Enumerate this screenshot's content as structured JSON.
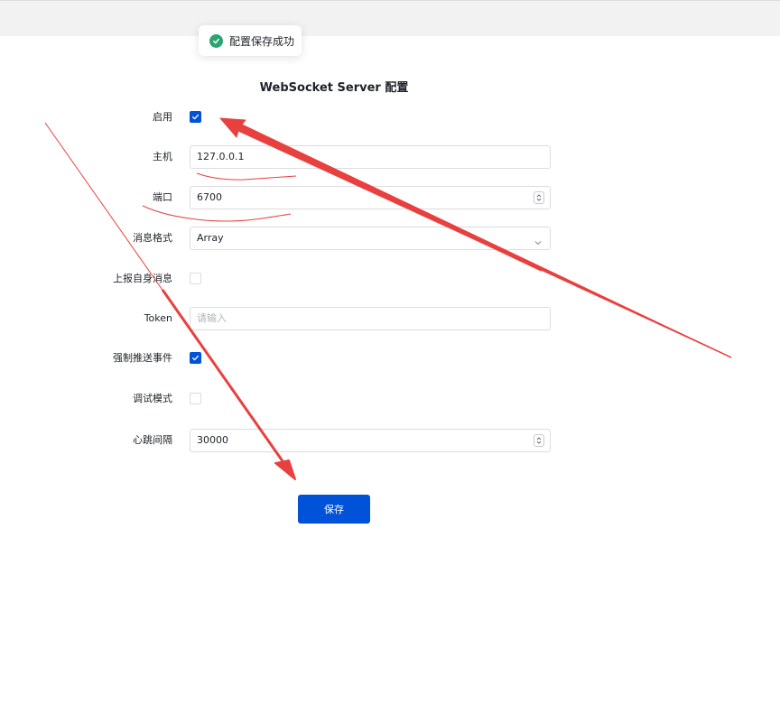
{
  "toast": {
    "icon": "check-circle-icon",
    "message": "配置保存成功",
    "color": "#2ba471"
  },
  "form": {
    "title": "WebSocket Server 配置",
    "enable_label": "启用",
    "enable_checked": true,
    "host_label": "主机",
    "host_value": "127.0.0.1",
    "port_label": "端口",
    "port_value": "6700",
    "message_format_label": "消息格式",
    "message_format_value": "Array",
    "report_self_label": "上报自身消息",
    "report_self_checked": false,
    "token_label": "Token",
    "token_placeholder": "请输入",
    "force_push_label": "强制推送事件",
    "force_push_checked": true,
    "debug_label": "调试模式",
    "debug_checked": false,
    "heartbeat_label": "心跳间隔",
    "heartbeat_value": "30000",
    "save_label": "保存"
  },
  "colors": {
    "primary": "#0052d9",
    "annotation": "#e8403f"
  }
}
